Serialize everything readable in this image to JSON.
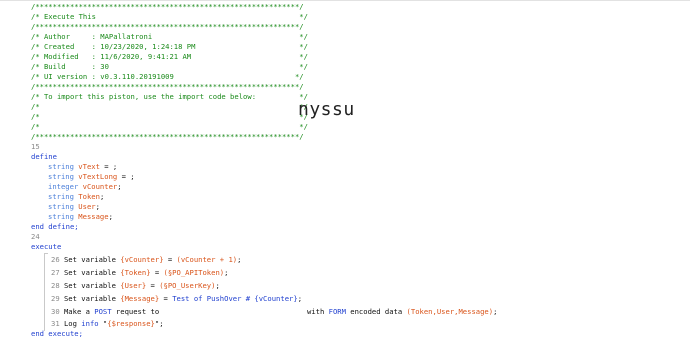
{
  "header": {
    "rule": "/*************************************************************/",
    "title": "/* Execute This                                               */",
    "author": "/* Author     : MAPallatroni                                  */",
    "created": "/* Created    : 10/23/2020, 1:24:18 PM                        */",
    "modified": "/* Modified   : 11/6/2020, 9:41:21 AM                         */",
    "build": "/* Build      : 30                                            */",
    "ui_version": "/* UI version : v0.3.110.20191009                            */",
    "import1": "/* To import this piston, use the import code below:          */",
    "import2": "/*                                                            */",
    "import3": "/*                                                            */",
    "import4": "/*                                                            */"
  },
  "overlay_text": "nyssu",
  "lines": {
    "n15": "15",
    "define": "define",
    "n24": "24",
    "execute": "execute",
    "end_define": "end define;",
    "end_execute": "end execute;"
  },
  "defines": [
    {
      "type": "string",
      "name": "vText",
      "rest": " = ;"
    },
    {
      "type": "string",
      "name": "vTextLong",
      "rest": " = ;"
    },
    {
      "type": "integer",
      "name": "vCounter",
      "rest": ";"
    },
    {
      "type": "string",
      "name": "Token",
      "rest": ";"
    },
    {
      "type": "string",
      "name": "User",
      "rest": ";"
    },
    {
      "type": "string",
      "name": "Message",
      "rest": ";"
    }
  ],
  "statements": [
    {
      "num": "26",
      "pre": "Set variable ",
      "var": "{vCounter}",
      "mid": " = ",
      "val": "(vCounter + 1)",
      "end": ";"
    },
    {
      "num": "27",
      "pre": "Set variable ",
      "var": "{Token}",
      "mid": " = ",
      "val": "(§PO_APIToken)",
      "end": ";"
    },
    {
      "num": "28",
      "pre": "Set variable ",
      "var": "{User}",
      "mid": " = ",
      "val": "(§PO_UserKey)",
      "end": ";"
    },
    {
      "num": "29",
      "pre": "Set variable ",
      "var": "{Message}",
      "mid": " = ",
      "val": "Test of PushOver # {vCounter}",
      "end": ";"
    }
  ],
  "request_line": {
    "num": "30",
    "pre": "Make a ",
    "method": "POST",
    "mid": " request to",
    "with": "with ",
    "form": "FORM",
    "encoded": " encoded data ",
    "data": "(Token,User,Message)",
    "end": ";"
  },
  "log_line": {
    "num": "31",
    "pre": "Log ",
    "level": "info",
    "mid": " \"",
    "val": "{$response}",
    "end": "\";"
  },
  "colors": {
    "comment": "#1a8a1a",
    "keyword": "#1f3fcf",
    "variable": "#d9541a",
    "line_number": "#8a8a8a"
  }
}
